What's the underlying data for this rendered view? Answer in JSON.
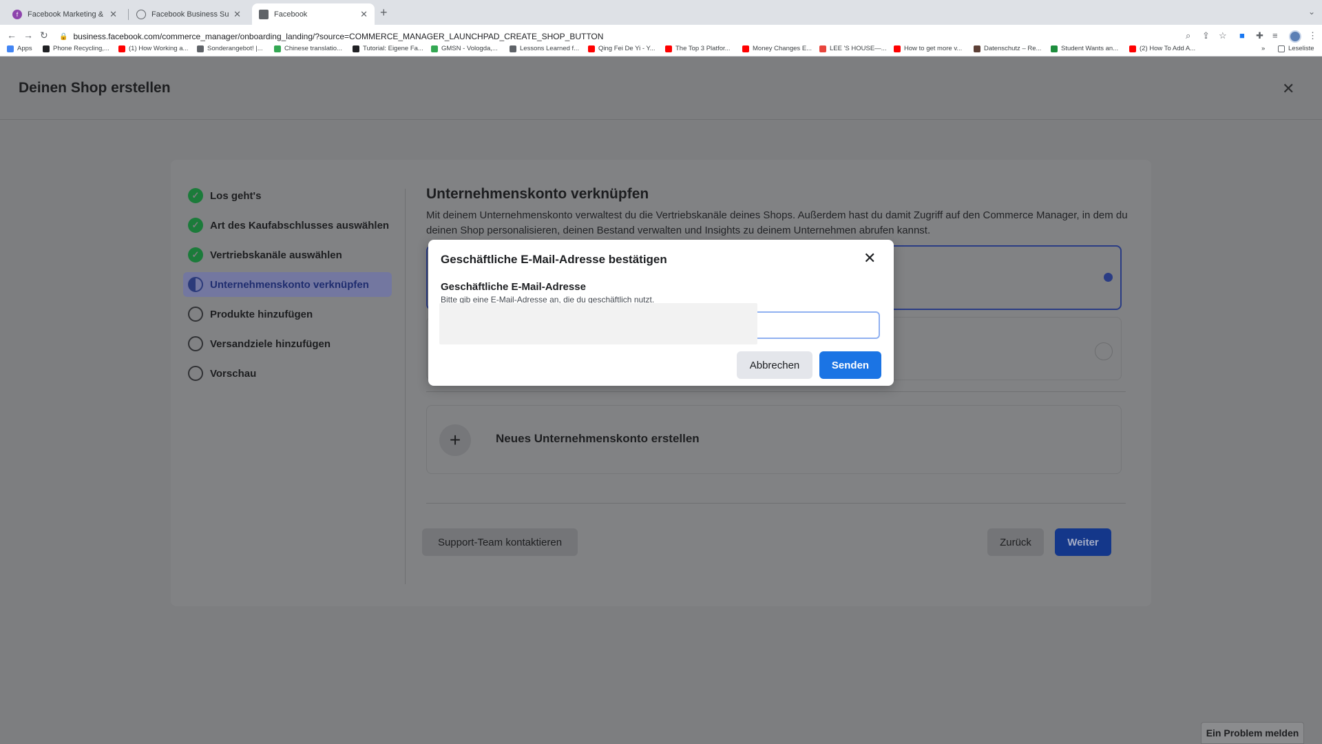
{
  "browser": {
    "tabs": [
      {
        "title": "Facebook Marketing & Werbe...",
        "color": "#8e44ad"
      },
      {
        "title": "Facebook Business Suite",
        "color": "#5f6368"
      },
      {
        "title": "Facebook",
        "color": "#5f6368"
      }
    ],
    "url": "business.facebook.com/commerce_manager/onboarding_landing/?source=COMMERCE_MANAGER_LAUNCHPAD_CREATE_SHOP_BUTTON",
    "bookmarks": [
      {
        "label": "Apps",
        "color": "#4285f4"
      },
      {
        "label": "Phone Recycling,...",
        "color": "#202124"
      },
      {
        "label": "(1) How Working a...",
        "color": "#ff0000"
      },
      {
        "label": "Sonderangebot! |...",
        "color": "#5f6368"
      },
      {
        "label": "Chinese translatio...",
        "color": "#34a853"
      },
      {
        "label": "Tutorial: Eigene Fa...",
        "color": "#202124"
      },
      {
        "label": "GMSN - Vologda,...",
        "color": "#34a853"
      },
      {
        "label": "Lessons Learned f...",
        "color": "#5f6368"
      },
      {
        "label": "Qing Fei De Yi - Y...",
        "color": "#ff0000"
      },
      {
        "label": "The Top 3 Platfor...",
        "color": "#ff0000"
      },
      {
        "label": "Money Changes E...",
        "color": "#ff0000"
      },
      {
        "label": "LEE 'S HOUSE—...",
        "color": "#e8453c"
      },
      {
        "label": "How to get more v...",
        "color": "#ff0000"
      },
      {
        "label": "Datenschutz – Re...",
        "color": "#5d4037"
      },
      {
        "label": "Student Wants an...",
        "color": "#1e8e3e"
      },
      {
        "label": "(2) How To Add A...",
        "color": "#ff0000"
      }
    ],
    "reading_list": "Leseliste"
  },
  "page": {
    "title": "Deinen Shop erstellen",
    "steps": [
      {
        "label": "Los geht's",
        "state": "done"
      },
      {
        "label": "Art des Kaufabschlusses auswählen",
        "state": "done"
      },
      {
        "label": "Vertriebskanäle auswählen",
        "state": "done"
      },
      {
        "label": "Unternehmenskonto verknüpfen",
        "state": "current"
      },
      {
        "label": "Produkte hinzufügen",
        "state": "todo"
      },
      {
        "label": "Versandziele hinzufügen",
        "state": "todo"
      },
      {
        "label": "Vorschau",
        "state": "todo"
      }
    ],
    "section_title": "Unternehmenskonto verknüpfen",
    "section_desc": "Mit deinem Unternehmenskonto verwaltest du die Vertriebskanäle deines Shops. Außerdem hast du damit Zugriff auf den Commerce Manager, in dem du deinen Shop personalisieren, deinen Bestand verwalten und Insights zu deinem Unternehmen abrufen kannst.",
    "new_account_label": "Neues Unternehmenskonto erstellen",
    "support_label": "Support-Team kontaktieren",
    "back_label": "Zurück",
    "next_label": "Weiter",
    "report_label": "Ein Problem melden"
  },
  "modal": {
    "title": "Geschäftliche E-Mail-Adresse bestätigen",
    "field_label": "Geschäftliche E-Mail-Adresse",
    "field_hint": "Bitte gib eine E-Mail-Adresse an, die du geschäftlich nutzt.",
    "input_value": "",
    "cancel_label": "Abbrechen",
    "send_label": "Senden"
  },
  "colors": {
    "primary_blue": "#1b74e4",
    "done_green": "#1b7b3a",
    "overlay_gray": "#7d7e80"
  }
}
